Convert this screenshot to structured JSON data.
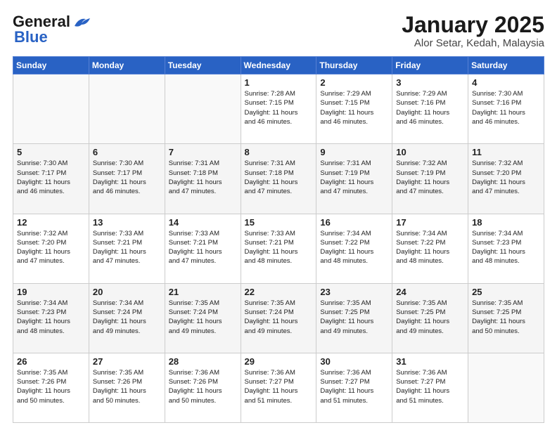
{
  "header": {
    "logo": "GeneralBlue",
    "title": "January 2025",
    "location": "Alor Setar, Kedah, Malaysia"
  },
  "weekdays": [
    "Sunday",
    "Monday",
    "Tuesday",
    "Wednesday",
    "Thursday",
    "Friday",
    "Saturday"
  ],
  "rows": [
    [
      {
        "day": "",
        "info": ""
      },
      {
        "day": "",
        "info": ""
      },
      {
        "day": "",
        "info": ""
      },
      {
        "day": "1",
        "info": "Sunrise: 7:28 AM\nSunset: 7:15 PM\nDaylight: 11 hours\nand 46 minutes."
      },
      {
        "day": "2",
        "info": "Sunrise: 7:29 AM\nSunset: 7:15 PM\nDaylight: 11 hours\nand 46 minutes."
      },
      {
        "day": "3",
        "info": "Sunrise: 7:29 AM\nSunset: 7:16 PM\nDaylight: 11 hours\nand 46 minutes."
      },
      {
        "day": "4",
        "info": "Sunrise: 7:30 AM\nSunset: 7:16 PM\nDaylight: 11 hours\nand 46 minutes."
      }
    ],
    [
      {
        "day": "5",
        "info": "Sunrise: 7:30 AM\nSunset: 7:17 PM\nDaylight: 11 hours\nand 46 minutes."
      },
      {
        "day": "6",
        "info": "Sunrise: 7:30 AM\nSunset: 7:17 PM\nDaylight: 11 hours\nand 46 minutes."
      },
      {
        "day": "7",
        "info": "Sunrise: 7:31 AM\nSunset: 7:18 PM\nDaylight: 11 hours\nand 47 minutes."
      },
      {
        "day": "8",
        "info": "Sunrise: 7:31 AM\nSunset: 7:18 PM\nDaylight: 11 hours\nand 47 minutes."
      },
      {
        "day": "9",
        "info": "Sunrise: 7:31 AM\nSunset: 7:19 PM\nDaylight: 11 hours\nand 47 minutes."
      },
      {
        "day": "10",
        "info": "Sunrise: 7:32 AM\nSunset: 7:19 PM\nDaylight: 11 hours\nand 47 minutes."
      },
      {
        "day": "11",
        "info": "Sunrise: 7:32 AM\nSunset: 7:20 PM\nDaylight: 11 hours\nand 47 minutes."
      }
    ],
    [
      {
        "day": "12",
        "info": "Sunrise: 7:32 AM\nSunset: 7:20 PM\nDaylight: 11 hours\nand 47 minutes."
      },
      {
        "day": "13",
        "info": "Sunrise: 7:33 AM\nSunset: 7:21 PM\nDaylight: 11 hours\nand 47 minutes."
      },
      {
        "day": "14",
        "info": "Sunrise: 7:33 AM\nSunset: 7:21 PM\nDaylight: 11 hours\nand 47 minutes."
      },
      {
        "day": "15",
        "info": "Sunrise: 7:33 AM\nSunset: 7:21 PM\nDaylight: 11 hours\nand 48 minutes."
      },
      {
        "day": "16",
        "info": "Sunrise: 7:34 AM\nSunset: 7:22 PM\nDaylight: 11 hours\nand 48 minutes."
      },
      {
        "day": "17",
        "info": "Sunrise: 7:34 AM\nSunset: 7:22 PM\nDaylight: 11 hours\nand 48 minutes."
      },
      {
        "day": "18",
        "info": "Sunrise: 7:34 AM\nSunset: 7:23 PM\nDaylight: 11 hours\nand 48 minutes."
      }
    ],
    [
      {
        "day": "19",
        "info": "Sunrise: 7:34 AM\nSunset: 7:23 PM\nDaylight: 11 hours\nand 48 minutes."
      },
      {
        "day": "20",
        "info": "Sunrise: 7:34 AM\nSunset: 7:24 PM\nDaylight: 11 hours\nand 49 minutes."
      },
      {
        "day": "21",
        "info": "Sunrise: 7:35 AM\nSunset: 7:24 PM\nDaylight: 11 hours\nand 49 minutes."
      },
      {
        "day": "22",
        "info": "Sunrise: 7:35 AM\nSunset: 7:24 PM\nDaylight: 11 hours\nand 49 minutes."
      },
      {
        "day": "23",
        "info": "Sunrise: 7:35 AM\nSunset: 7:25 PM\nDaylight: 11 hours\nand 49 minutes."
      },
      {
        "day": "24",
        "info": "Sunrise: 7:35 AM\nSunset: 7:25 PM\nDaylight: 11 hours\nand 49 minutes."
      },
      {
        "day": "25",
        "info": "Sunrise: 7:35 AM\nSunset: 7:25 PM\nDaylight: 11 hours\nand 50 minutes."
      }
    ],
    [
      {
        "day": "26",
        "info": "Sunrise: 7:35 AM\nSunset: 7:26 PM\nDaylight: 11 hours\nand 50 minutes."
      },
      {
        "day": "27",
        "info": "Sunrise: 7:35 AM\nSunset: 7:26 PM\nDaylight: 11 hours\nand 50 minutes."
      },
      {
        "day": "28",
        "info": "Sunrise: 7:36 AM\nSunset: 7:26 PM\nDaylight: 11 hours\nand 50 minutes."
      },
      {
        "day": "29",
        "info": "Sunrise: 7:36 AM\nSunset: 7:27 PM\nDaylight: 11 hours\nand 51 minutes."
      },
      {
        "day": "30",
        "info": "Sunrise: 7:36 AM\nSunset: 7:27 PM\nDaylight: 11 hours\nand 51 minutes."
      },
      {
        "day": "31",
        "info": "Sunrise: 7:36 AM\nSunset: 7:27 PM\nDaylight: 11 hours\nand 51 minutes."
      },
      {
        "day": "",
        "info": ""
      }
    ]
  ]
}
